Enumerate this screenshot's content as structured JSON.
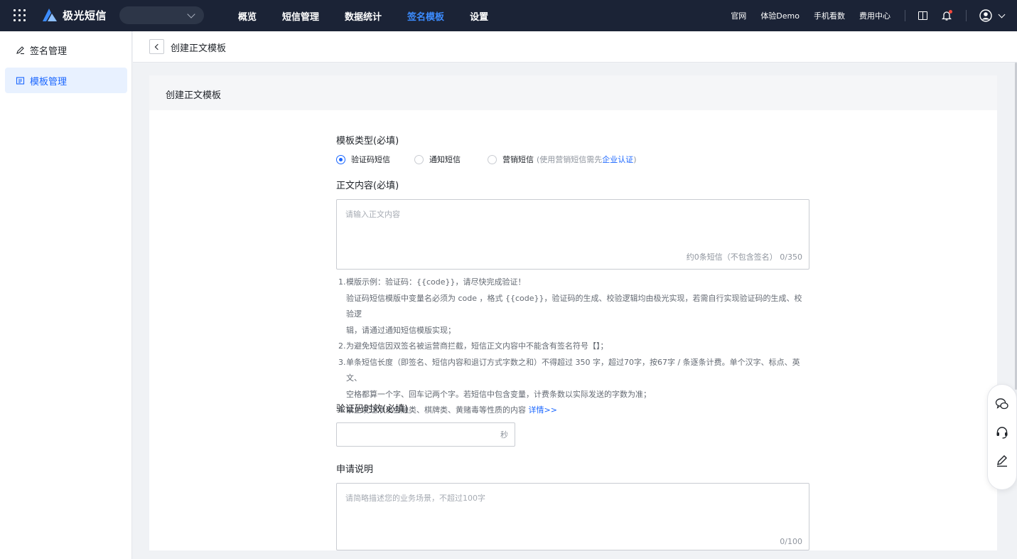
{
  "topbar": {
    "brand": "极光短信",
    "nav": [
      {
        "label": "概览",
        "active": false
      },
      {
        "label": "短信管理",
        "active": false
      },
      {
        "label": "数据统计",
        "active": false
      },
      {
        "label": "签名模板",
        "active": true
      },
      {
        "label": "设置",
        "active": false
      }
    ],
    "links": [
      "官网",
      "体验Demo",
      "手机看数",
      "费用中心"
    ],
    "icons": {
      "apps": "apps-grid-icon",
      "docs": "book-icon",
      "notify": "bell-icon",
      "user": "user-avatar-icon"
    }
  },
  "sidebar": {
    "items": [
      {
        "label": "签名管理",
        "icon": "pen-icon",
        "active": false
      },
      {
        "label": "模板管理",
        "icon": "template-icon",
        "active": true
      }
    ]
  },
  "page": {
    "title": "创建正文模板"
  },
  "form": {
    "card_title": "创建正文模板",
    "template_type": {
      "label": "模板类型(必填)",
      "options": [
        {
          "label": "验证码短信",
          "selected": true
        },
        {
          "label": "通知短信",
          "selected": false
        },
        {
          "label": "营销短信",
          "selected": false
        }
      ],
      "marketing_hint_prefix": "(使用营销短信需先",
      "marketing_hint_link": "企业认证",
      "marketing_hint_suffix": ")"
    },
    "content": {
      "label": "正文内容(必填)",
      "placeholder": "请输入正文内容",
      "counter": "约0条短信（不包含签名） 0/350"
    },
    "tips": [
      {
        "num": "1.",
        "lines": [
          "模版示例：验证码：{{code}}，请尽快完成验证！",
          "验证码短信模版中变量名必须为 code ，格式 {{code}}，验证码的生成、校验逻辑均由极光实现，若需自行实现验证码的生成、校验逻",
          "辑，请通过通知短信模版实现；"
        ]
      },
      {
        "num": "2.",
        "lines": [
          "为避免短信因双签名被运营商拦截，短信正文内容中不能含有签名符号【】；"
        ]
      },
      {
        "num": "3.",
        "lines": [
          "单条短信长度（即签名、短信内容和退订方式字数之和）不得超过 350 字，超过70字，按67字 / 条逐条计费。单个汉字、标点、英文、",
          "空格都算一个字、回车记两个字。若短信中包含变量，计费条数以实际发送的字数为准；"
        ]
      },
      {
        "num": "4.",
        "lines": [
          "禁止发送涉及金融类、棋牌类、黄赌毒等性质的内容"
        ],
        "link": "详情>>"
      }
    ],
    "code_validity": {
      "label": "验证码时效(必填)",
      "suffix": "秒"
    },
    "description": {
      "label": "申请说明",
      "placeholder": "请简略描述您的业务场景，不超过100字",
      "counter": "0/100"
    }
  },
  "floatbar": {
    "icons": [
      "wechat-icon",
      "headset-icon",
      "edit-icon"
    ]
  }
}
